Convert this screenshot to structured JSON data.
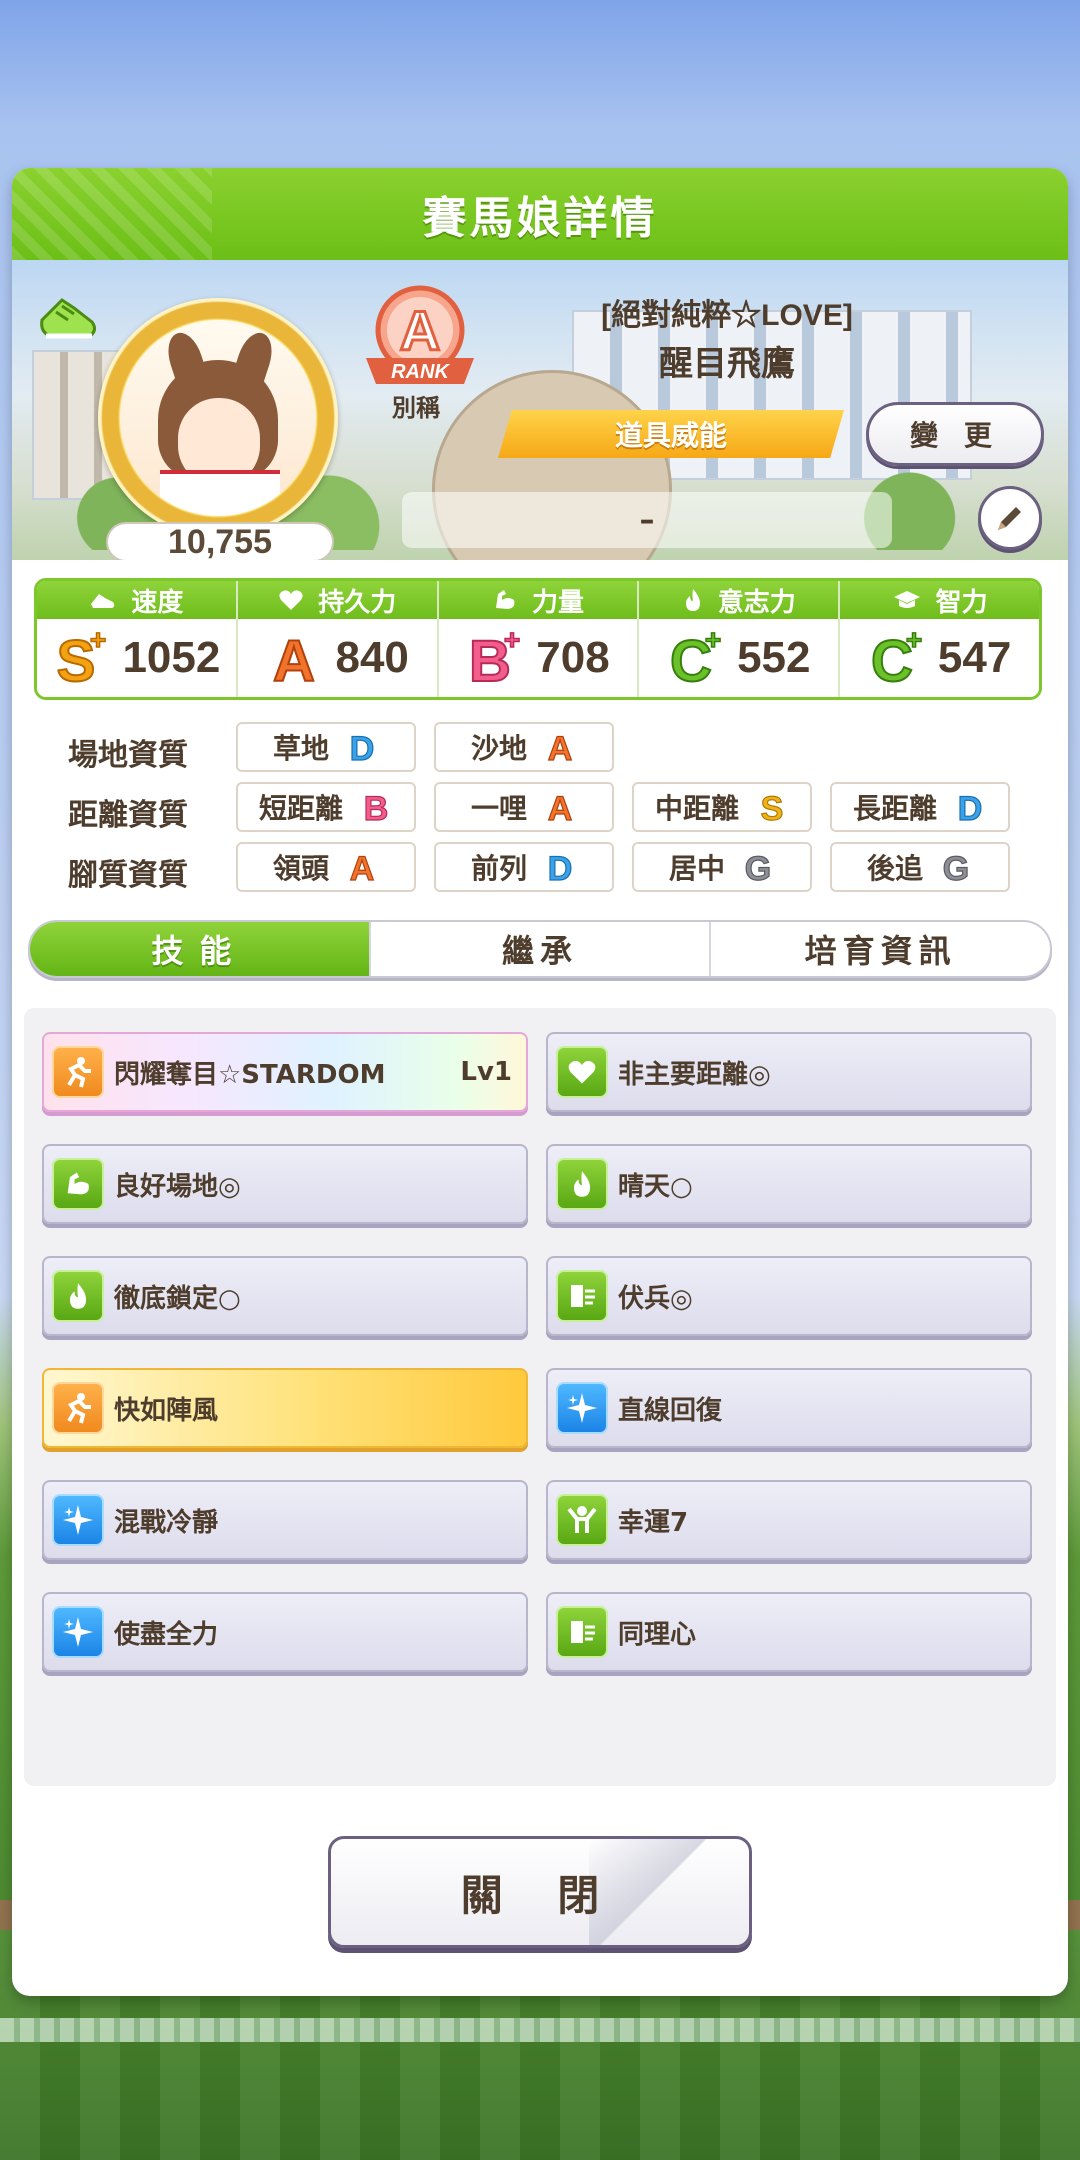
{
  "header": {
    "title": "賽馬娘詳情"
  },
  "profile": {
    "score": "10,755",
    "rank": "A",
    "rank_word": "RANK",
    "alias_label": "別稱",
    "epithet": "[絕對純粹☆LOVE]",
    "name": "醒目飛鷹",
    "title_banner": "道具威能",
    "change_button": "變 更",
    "title_slot_value": "–"
  },
  "stats": [
    {
      "label": "速度",
      "grade": "S",
      "plus": true,
      "value": "1052",
      "icon": "shoe-icon",
      "color": "#f3a214"
    },
    {
      "label": "持久力",
      "grade": "A",
      "plus": false,
      "value": "840",
      "icon": "heart-icon",
      "color": "#f2742a"
    },
    {
      "label": "力量",
      "grade": "B",
      "plus": true,
      "value": "708",
      "icon": "muscle-icon",
      "color": "#f25d8c"
    },
    {
      "label": "意志力",
      "grade": "C",
      "plus": true,
      "value": "552",
      "icon": "flame-icon",
      "color": "#6cc12a"
    },
    {
      "label": "智力",
      "grade": "C",
      "plus": true,
      "value": "547",
      "icon": "graduation-cap-icon",
      "color": "#6cc12a"
    }
  ],
  "aptitudes": {
    "track": {
      "label": "場地資質",
      "items": [
        {
          "name": "草地",
          "grade": "D"
        },
        {
          "name": "沙地",
          "grade": "A"
        }
      ]
    },
    "distance": {
      "label": "距離資質",
      "items": [
        {
          "name": "短距離",
          "grade": "B"
        },
        {
          "name": "一哩",
          "grade": "A"
        },
        {
          "name": "中距離",
          "grade": "S"
        },
        {
          "name": "長距離",
          "grade": "D"
        }
      ]
    },
    "style": {
      "label": "腳質資質",
      "items": [
        {
          "name": "領頭",
          "grade": "A"
        },
        {
          "name": "前列",
          "grade": "D"
        },
        {
          "name": "居中",
          "grade": "G"
        },
        {
          "name": "後追",
          "grade": "G"
        }
      ]
    }
  },
  "grade_colors": {
    "S": "#f0b21c",
    "A": "#f2742a",
    "B": "#f25d8c",
    "C": "#6cc12a",
    "D": "#3aa2e8",
    "G": "#8e8e96"
  },
  "tabs": [
    "技能",
    "繼承",
    "培育資訊"
  ],
  "skills": [
    {
      "name": "閃耀奪目☆STARDOM",
      "level": "Lv1",
      "style": "rainbow",
      "icon": "runner-icon",
      "icon_color": "orange"
    },
    {
      "name": "非主要距離◎",
      "level": "",
      "style": "normal",
      "icon": "heart-icon",
      "icon_color": "green"
    },
    {
      "name": "良好場地◎",
      "level": "",
      "style": "normal",
      "icon": "muscle-icon",
      "icon_color": "green"
    },
    {
      "name": "晴天○",
      "level": "",
      "style": "normal",
      "icon": "flame-icon",
      "icon_color": "green"
    },
    {
      "name": "徹底鎖定○",
      "level": "",
      "style": "normal",
      "icon": "flame-icon",
      "icon_color": "green"
    },
    {
      "name": "伏兵◎",
      "level": "",
      "style": "normal",
      "icon": "document-icon",
      "icon_color": "green"
    },
    {
      "name": "快如陣風",
      "level": "",
      "style": "gold",
      "icon": "runner-icon",
      "icon_color": "orange"
    },
    {
      "name": "直線回復",
      "level": "",
      "style": "normal",
      "icon": "sparkle-icon",
      "icon_color": "blue"
    },
    {
      "name": "混戰冷靜",
      "level": "",
      "style": "normal",
      "icon": "sparkle-icon",
      "icon_color": "blue"
    },
    {
      "name": "幸運7",
      "level": "",
      "style": "normal",
      "icon": "cheer-icon",
      "icon_color": "green"
    },
    {
      "name": "使盡全力",
      "level": "",
      "style": "normal",
      "icon": "sparkle-icon",
      "icon_color": "blue"
    },
    {
      "name": "同理心",
      "level": "",
      "style": "normal",
      "icon": "document-icon",
      "icon_color": "green"
    }
  ],
  "close_button": "關 閉"
}
